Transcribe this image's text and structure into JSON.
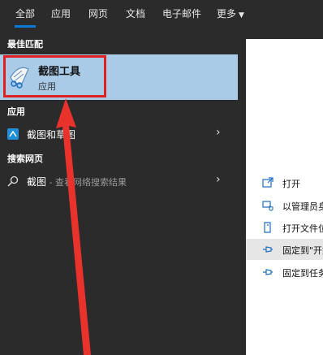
{
  "tabs": [
    {
      "label": "全部",
      "active": true
    },
    {
      "label": "应用"
    },
    {
      "label": "网页"
    },
    {
      "label": "文档"
    },
    {
      "label": "电子邮件"
    },
    {
      "label": "更多"
    }
  ],
  "sections": {
    "best_match": "最佳匹配",
    "apps": "应用",
    "web": "搜索网页"
  },
  "best_match": {
    "title": "截图工具",
    "subtitle": "应用"
  },
  "apps": [
    {
      "label": "截图和草图"
    }
  ],
  "web": {
    "query": "截图",
    "hint": " - 查看网络搜索结果"
  },
  "actions": [
    {
      "label": "打开"
    },
    {
      "label": "以管理员身"
    },
    {
      "label": "打开文件位"
    },
    {
      "label": "固定到\"开始"
    },
    {
      "label": "固定到任务"
    }
  ],
  "colors": {
    "background": "#2b2b2b",
    "selected": "#a9cbe8",
    "accent": "#0a78d7",
    "annotation": "#e02020"
  }
}
